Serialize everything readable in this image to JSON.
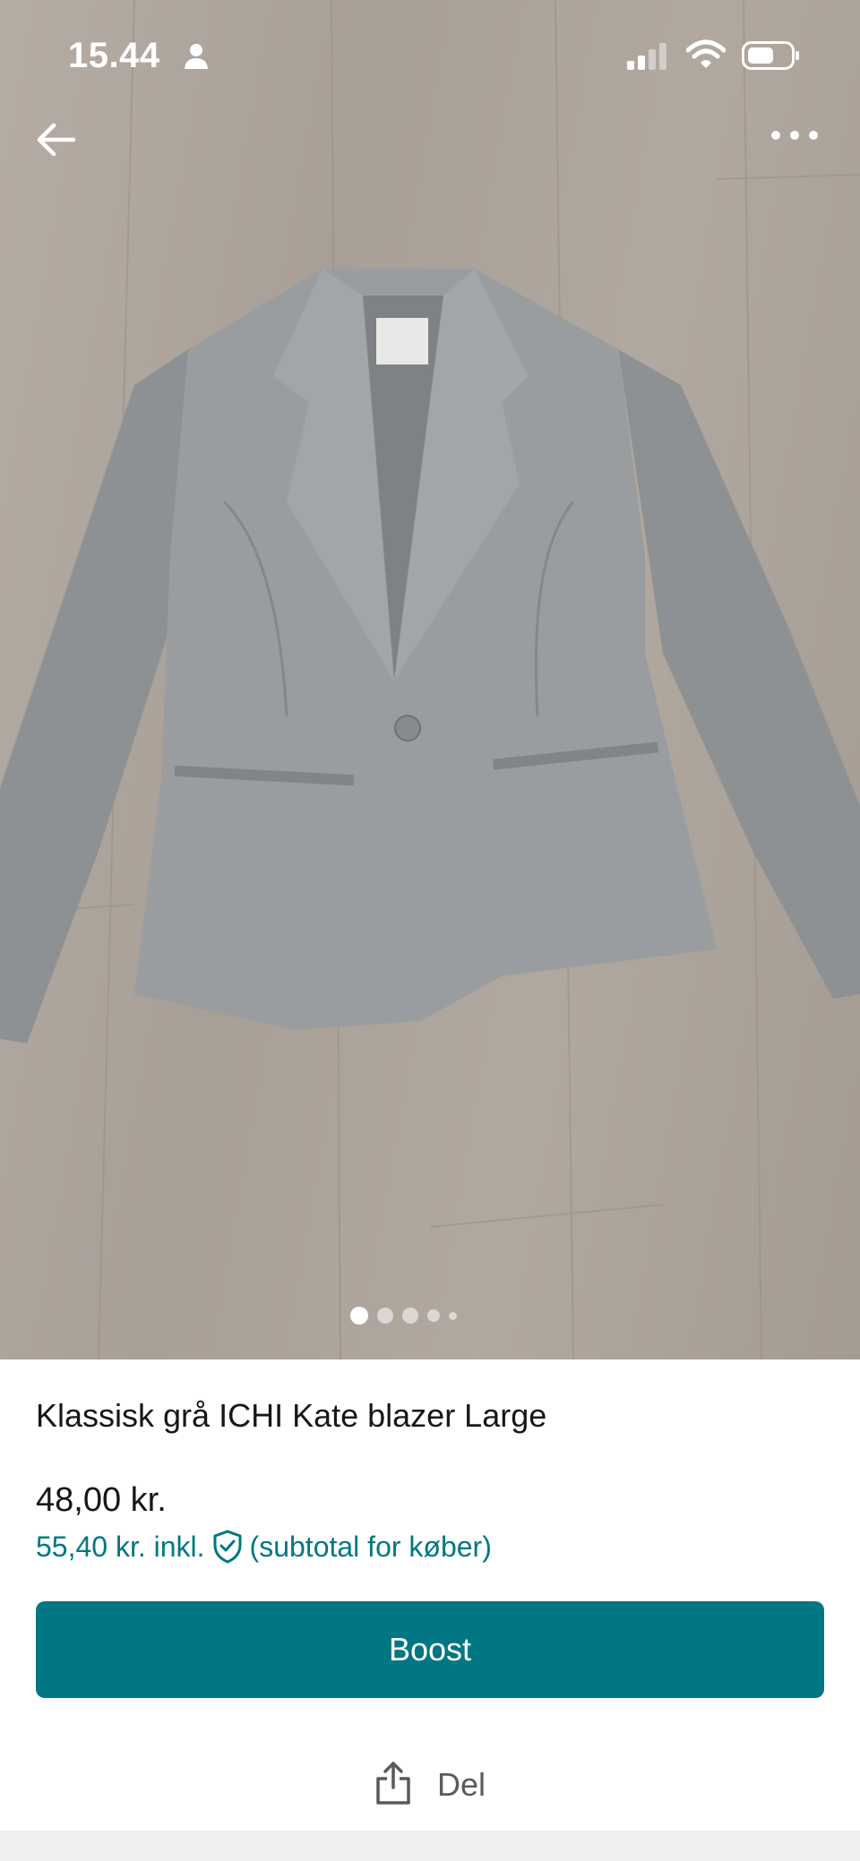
{
  "status_bar": {
    "time": "15.44",
    "icons": [
      "person-icon",
      "signal-icon",
      "wifi-icon",
      "battery-icon"
    ]
  },
  "nav": {
    "back_icon": "arrow-left-icon",
    "more_icon": "more-horizontal-icon"
  },
  "gallery": {
    "image_description_icon": "product-photo",
    "page_count": 5,
    "current_page": 1
  },
  "item": {
    "title": "Klassisk grå ICHI Kate blazer Large",
    "price": "48,00 kr.",
    "price_incl": "55,40 kr. inkl.",
    "price_incl_suffix": "(subtotal for køber)",
    "protection_icon": "shield-check-icon"
  },
  "actions": {
    "boost_label": "Boost",
    "share_label": "Del",
    "share_icon": "share-icon"
  },
  "colors": {
    "accent": "#007782",
    "text": "#171717",
    "muted": "#5a5a5a"
  }
}
